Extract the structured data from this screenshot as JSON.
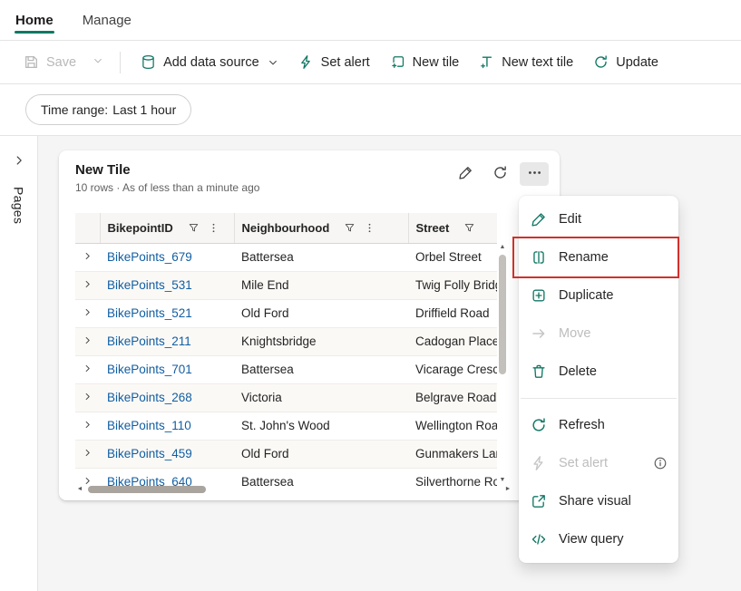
{
  "colors": {
    "accent_teal": "#117865",
    "link_blue": "#115ea3",
    "highlight_red": "#d0312d"
  },
  "tabs": {
    "home": "Home",
    "manage": "Manage"
  },
  "toolbar": {
    "save": "Save",
    "add_data_source": "Add data source",
    "set_alert": "Set alert",
    "new_tile": "New tile",
    "new_text_tile": "New text tile",
    "update": "Update"
  },
  "time_range": {
    "label": "Time range:",
    "value": "Last 1 hour"
  },
  "sidebar": {
    "pages": "Pages"
  },
  "tile": {
    "title": "New Tile",
    "subtitle": "10 rows · As of less than a minute ago",
    "table": {
      "columns": [
        {
          "label": "BikepointID",
          "filter": true,
          "kebab": true
        },
        {
          "label": "Neighbourhood",
          "filter": true,
          "kebab": true
        },
        {
          "label": "Street",
          "filter": true,
          "kebab": false
        }
      ],
      "rows": [
        [
          "BikePoints_679",
          "Battersea",
          "Orbel Street"
        ],
        [
          "BikePoints_531",
          "Mile End",
          "Twig Folly Bridg"
        ],
        [
          "BikePoints_521",
          "Old Ford",
          "Driffield Road"
        ],
        [
          "BikePoints_211",
          "Knightsbridge",
          "Cadogan Place"
        ],
        [
          "BikePoints_701",
          "Battersea",
          "Vicarage Cresc"
        ],
        [
          "BikePoints_268",
          "Victoria",
          "Belgrave Road"
        ],
        [
          "BikePoints_110",
          "St. John's Wood",
          "Wellington Roa"
        ],
        [
          "BikePoints_459",
          "Old Ford",
          "Gunmakers Lar"
        ],
        [
          "BikePoints_640",
          "Battersea",
          "Silverthorne Ro"
        ]
      ]
    }
  },
  "context_menu": {
    "items": [
      {
        "type": "item",
        "label": "Edit",
        "icon": "edit-icon",
        "enabled": true
      },
      {
        "type": "item",
        "label": "Rename",
        "icon": "rename-icon",
        "enabled": true,
        "highlighted": true
      },
      {
        "type": "item",
        "label": "Duplicate",
        "icon": "duplicate-icon",
        "enabled": true
      },
      {
        "type": "item",
        "label": "Move",
        "icon": "move-icon",
        "enabled": false
      },
      {
        "type": "item",
        "label": "Delete",
        "icon": "delete-icon",
        "enabled": true
      },
      {
        "type": "divider"
      },
      {
        "type": "item",
        "label": "Refresh",
        "icon": "refresh-icon",
        "enabled": true
      },
      {
        "type": "item",
        "label": "Set alert",
        "icon": "alert-icon",
        "enabled": false,
        "trailing": "info-icon"
      },
      {
        "type": "item",
        "label": "Share visual",
        "icon": "share-icon",
        "enabled": true
      },
      {
        "type": "item",
        "label": "View query",
        "icon": "code-icon",
        "enabled": true
      }
    ]
  }
}
